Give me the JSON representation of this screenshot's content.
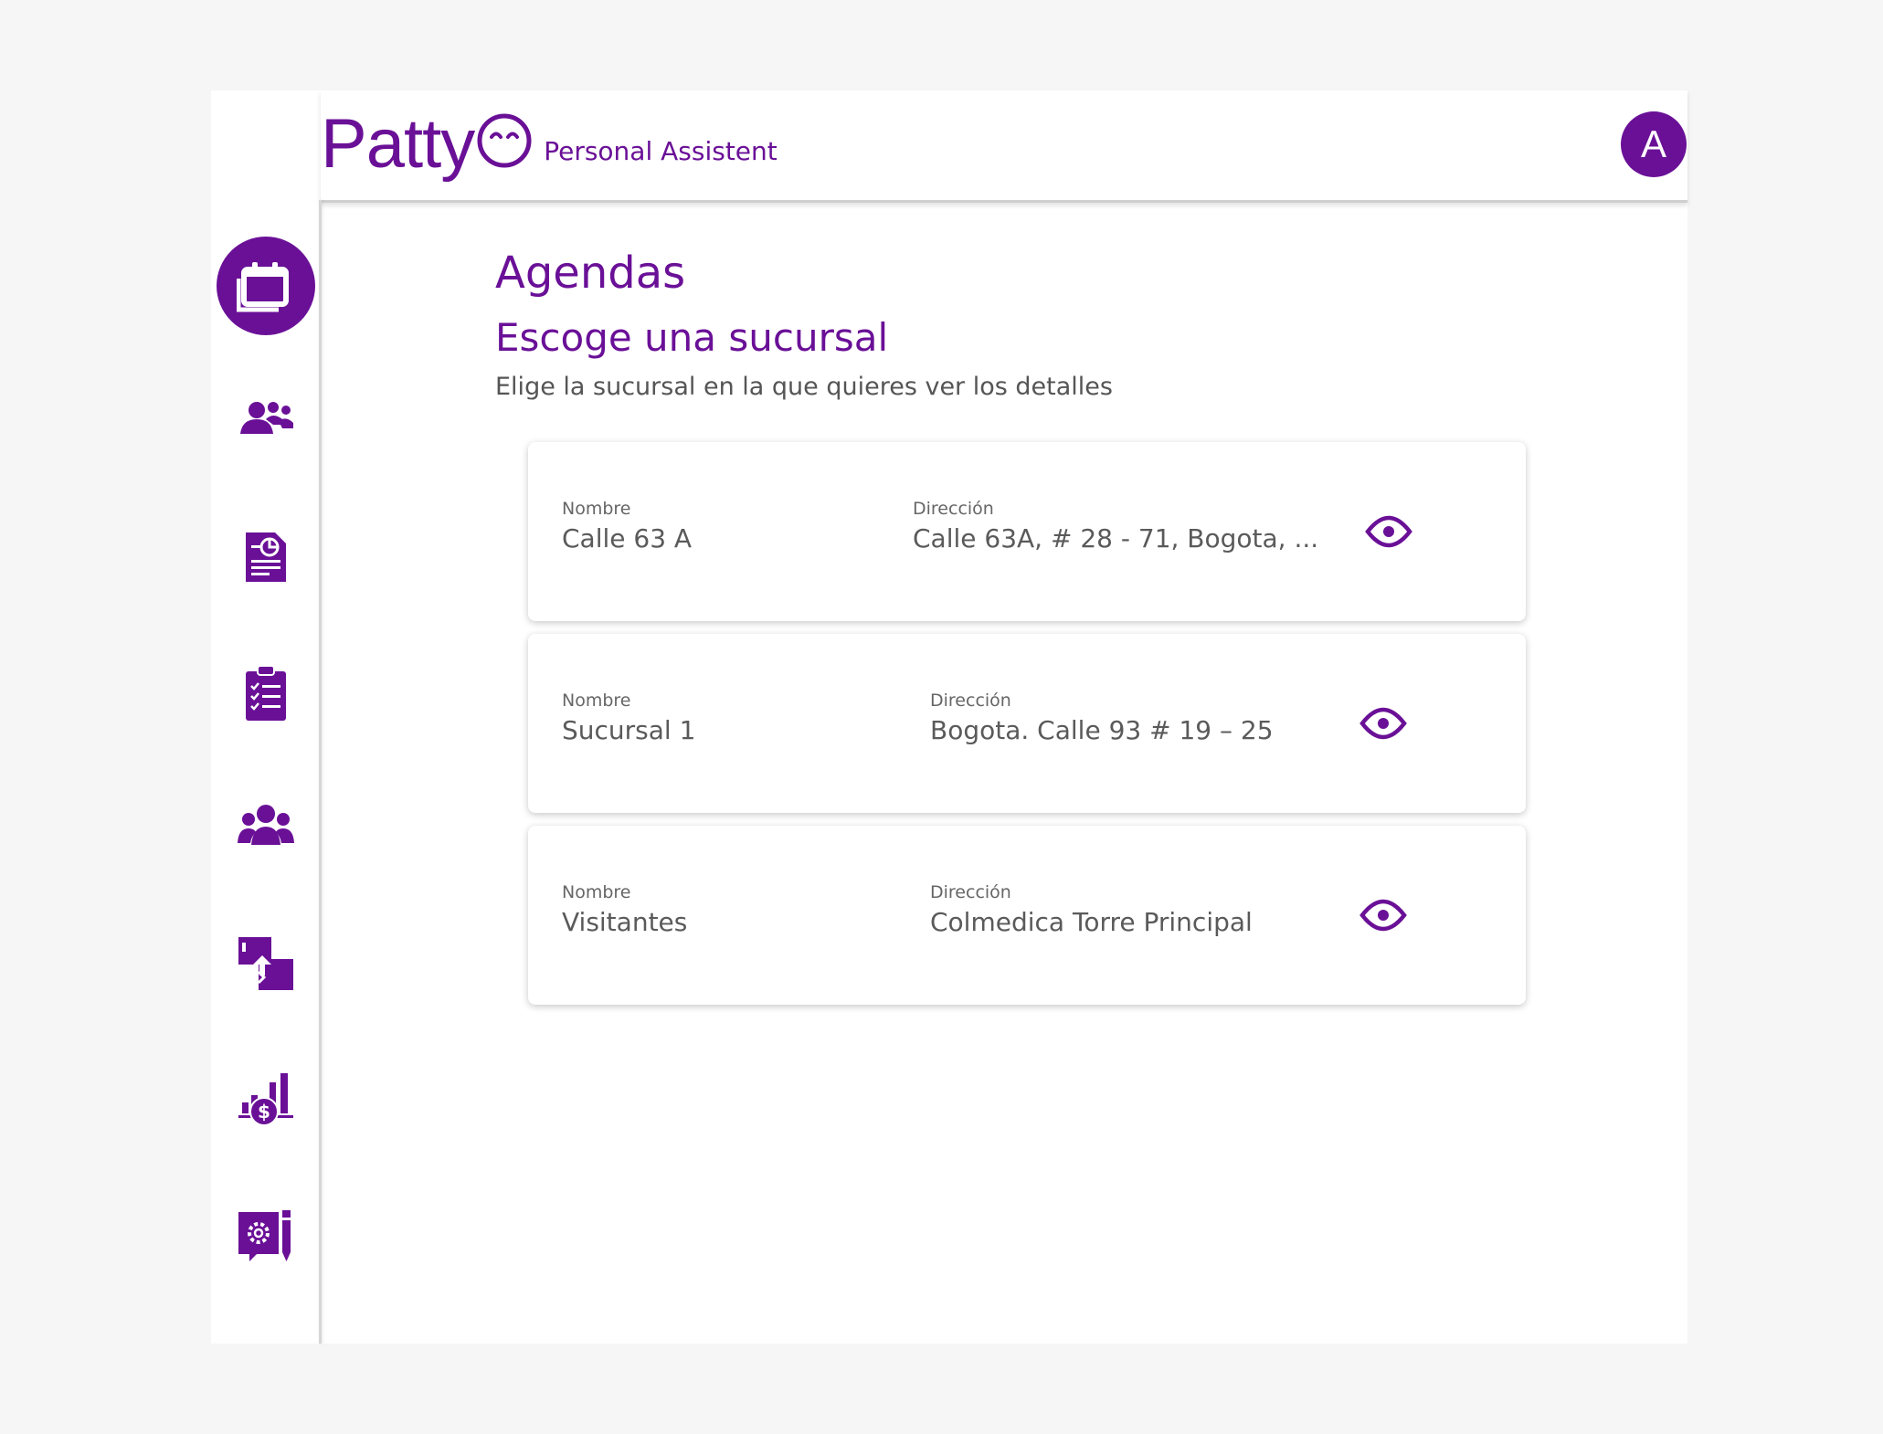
{
  "header": {
    "logo_text": "Patty",
    "logo_tagline": "Personal Assistent",
    "avatar_initial": "A"
  },
  "sidebar": {
    "items": [
      {
        "icon": "calendar-icon",
        "active": true
      },
      {
        "icon": "users-icon",
        "active": false
      },
      {
        "icon": "report-icon",
        "active": false
      },
      {
        "icon": "clipboard-checklist-icon",
        "active": false
      },
      {
        "icon": "team-icon",
        "active": false
      },
      {
        "icon": "transfer-icon",
        "active": false
      },
      {
        "icon": "finance-chart-icon",
        "active": false
      },
      {
        "icon": "settings-document-icon",
        "active": false
      }
    ]
  },
  "main": {
    "title": "Agendas",
    "subtitle": "Escoge una sucursal",
    "description": "Elige la sucursal en la que quieres ver los detalles",
    "name_label": "Nombre",
    "address_label": "Dirección",
    "branches": [
      {
        "name": "Calle 63 A",
        "address": "Calle 63A, # 28 - 71, Bogota, ..."
      },
      {
        "name": "Sucursal 1",
        "address": "Bogota. Calle 93 # 19 – 25"
      },
      {
        "name": "Visitantes",
        "address": "Colmedica Torre Principal"
      }
    ]
  },
  "colors": {
    "brand": "#6a1097",
    "background": "#f6f6f6",
    "text": "#555555"
  }
}
